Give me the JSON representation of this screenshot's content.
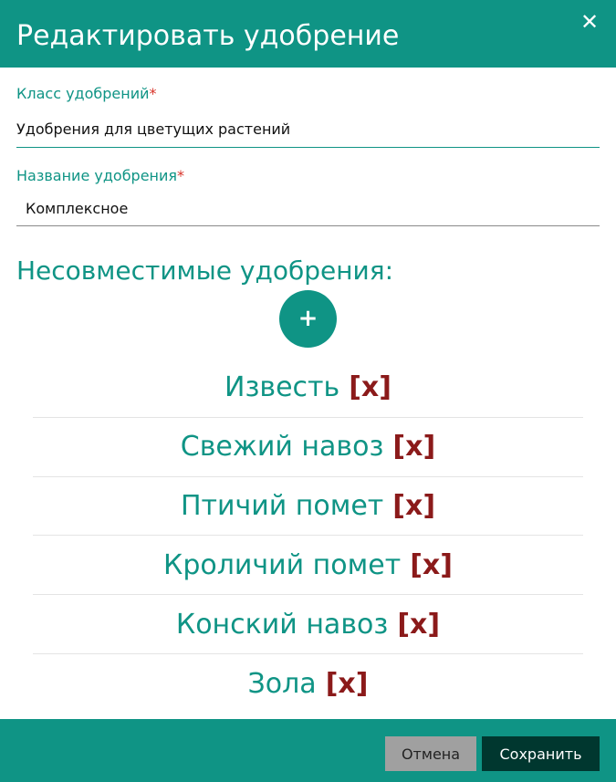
{
  "dialog": {
    "title": "Редактировать удобрение",
    "close_glyph": "✕",
    "close_icon": "close-icon"
  },
  "form": {
    "class_field": {
      "label": "Класс удобрений",
      "required_mark": "*",
      "value": "Удобрения для цветущих растений"
    },
    "name_field": {
      "label": "Название удобрения",
      "required_mark": "*",
      "value": "Комплексное"
    }
  },
  "incompatible": {
    "title": "Несовместимые удобрения:",
    "add_glyph": "+",
    "add_icon": "plus-icon",
    "remove_label": "[x]",
    "items": [
      {
        "name": "Известь"
      },
      {
        "name": "Свежий навоз"
      },
      {
        "name": "Птичий помет"
      },
      {
        "name": "Кроличий помет"
      },
      {
        "name": "Конский навоз"
      },
      {
        "name": "Зола"
      }
    ]
  },
  "footer": {
    "cancel_label": "Отмена",
    "save_label": "Сохранить"
  },
  "colors": {
    "brand": "#0f9485",
    "required": "#d8342a",
    "remove": "#8b1a1a",
    "save_button": "#00372f",
    "cancel_button": "#a0a0a0"
  }
}
